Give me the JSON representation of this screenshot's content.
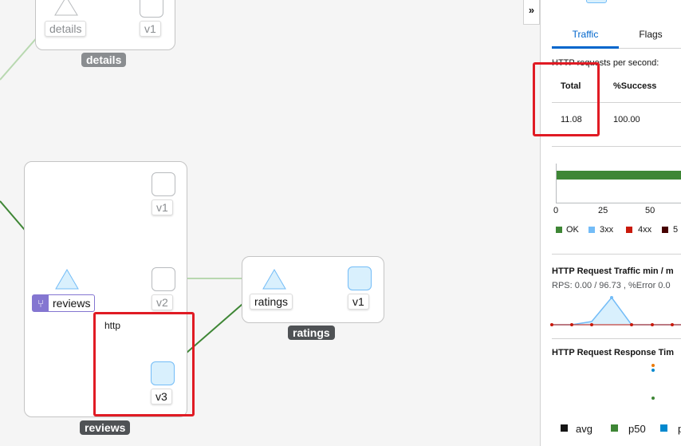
{
  "graph": {
    "groups": [
      {
        "name": "details",
        "color": "#8a8d90"
      },
      {
        "name": "reviews",
        "color": "#4f5255"
      },
      {
        "name": "ratings",
        "color": "#4f5255"
      }
    ],
    "details_nodes": {
      "service": "details",
      "version": "v1"
    },
    "reviews_nodes": {
      "service": "reviews",
      "v1": "v1",
      "v2": "v2",
      "v3": "v3"
    },
    "ratings_nodes": {
      "service": "ratings",
      "version": "v1"
    },
    "edge_label": "http",
    "colors": {
      "healthy_edge": "#3e8635",
      "idle_edge": "#b8d8b0",
      "highlight": "#e01b24",
      "active_node": "#73bcf7"
    }
  },
  "panel": {
    "collapse_icon": "»",
    "tabs": [
      {
        "label": "Traffic",
        "active": true
      },
      {
        "label": "Flags",
        "active": false
      }
    ],
    "http_title": "HTTP requests per second:",
    "table": {
      "headers": [
        "Total",
        "%Success"
      ],
      "row": [
        "11.08",
        "100.00"
      ]
    },
    "bar_axis_ticks": [
      "0",
      "25",
      "50"
    ],
    "legend": [
      {
        "label": "OK",
        "color": "#3e8635"
      },
      {
        "label": "3xx",
        "color": "#73bcf7"
      },
      {
        "label": "4xx",
        "color": "#c9190b"
      },
      {
        "label": "5",
        "color": "#470000"
      }
    ],
    "traffic_title": "HTTP Request Traffic min / m",
    "traffic_stats": "RPS: 0.00 / 96.73 , %Error 0.0",
    "response_title": "HTTP Request Response Tim",
    "resp_legend": [
      {
        "label": "avg",
        "color": "#151515"
      },
      {
        "label": "p50",
        "color": "#3e8635"
      },
      {
        "label": "p",
        "color": "#0088ce"
      }
    ]
  }
}
